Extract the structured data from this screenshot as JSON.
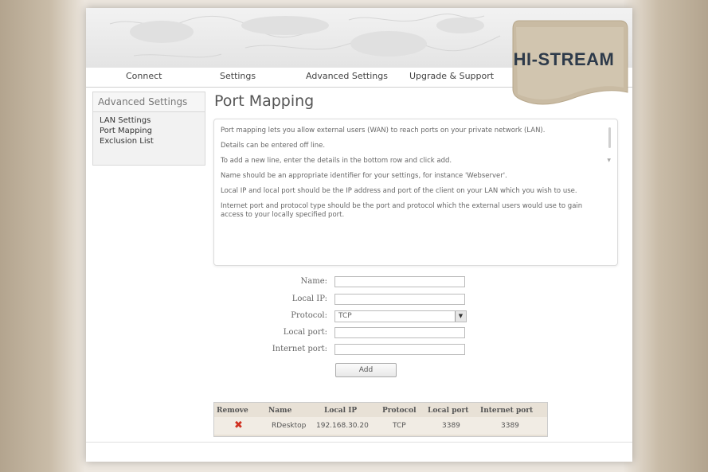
{
  "nav": {
    "items": [
      "Connect",
      "Settings",
      "Advanced Settings",
      "Upgrade & Support"
    ]
  },
  "logo": {
    "text": "HI-STREAM"
  },
  "sidebar": {
    "title": "Advanced Settings",
    "items": [
      "LAN Settings",
      "Port Mapping",
      "Exclusion List"
    ]
  },
  "page": {
    "title": "Port Mapping"
  },
  "info": {
    "paragraphs": [
      "Port mapping lets you allow external users (WAN) to reach ports on your private network (LAN).",
      "Details can be entered off line.",
      "To add a new line, enter the details in the bottom row and click add.",
      "Name should be an appropriate identifier for your settings, for instance 'Webserver'.",
      "Local IP and local port should be the IP address and port of the client on your LAN which you wish to use.",
      "Internet port and protocol type should be the port and protocol which the external users would use to gain access to your locally specified port."
    ]
  },
  "form": {
    "name_label": "Name:",
    "local_ip_label": "Local IP:",
    "protocol_label": "Protocol:",
    "protocol_value": "TCP",
    "local_port_label": "Local port:",
    "internet_port_label": "Internet port:",
    "name_value": "",
    "local_ip_value": "",
    "local_port_value": "",
    "internet_port_value": "",
    "add_label": "Add"
  },
  "table": {
    "headers": [
      "Remove",
      "Name",
      "Local IP",
      "Protocol",
      "Local port",
      "Internet port"
    ],
    "rows": [
      {
        "name": "RDesktop",
        "local_ip": "192.168.30.20",
        "protocol": "TCP",
        "local_port": "3389",
        "internet_port": "3389"
      }
    ]
  },
  "colors": {
    "accent_tan": "#e8e1d6",
    "logo_bg": "#c9bba3",
    "remove_red": "#d03020"
  },
  "icons": [
    "remove-x-icon",
    "dropdown-arrow-icon",
    "world-map-background"
  ]
}
